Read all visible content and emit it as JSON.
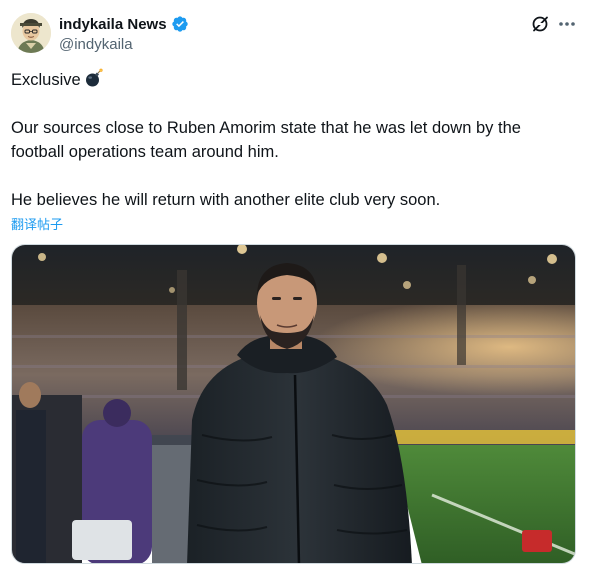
{
  "post": {
    "author": {
      "display_name": "indykaila News",
      "handle": "@indykaila",
      "verified": true,
      "avatar_icon": "avatar-illustration"
    },
    "actions": {
      "grok_icon": "grok-icon",
      "more_icon": "more-horizontal-icon"
    },
    "body": {
      "line1": "Exclusive",
      "line1_emoji": "bomb-emoji",
      "line2": "Our sources close to Ruben Amorim state that he was let down by the",
      "line3": "football operations team around him.",
      "line4": "He believes he will return with another elite club very soon."
    },
    "translate_label": "翻译帖子",
    "media": {
      "type": "photo",
      "description_icon": "photo"
    }
  },
  "colors": {
    "text_primary": "#0f1419",
    "text_secondary": "#536471",
    "link": "#1d9bf0",
    "verified_badge": "#1d9bf0"
  }
}
